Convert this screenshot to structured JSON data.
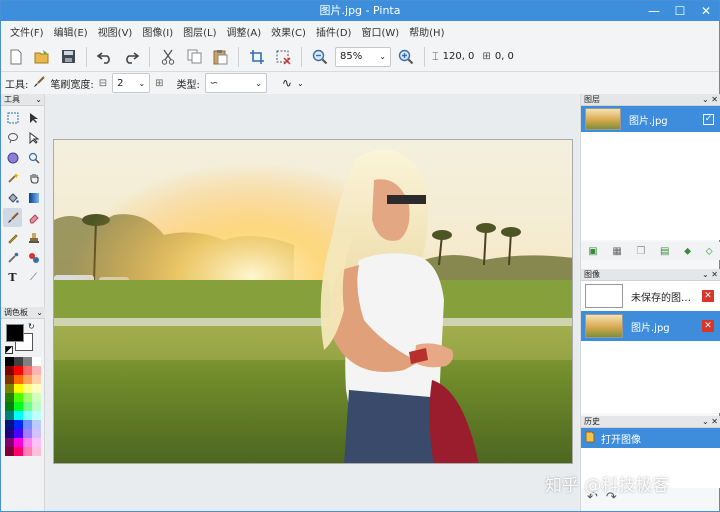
{
  "window": {
    "title": "图片.jpg - Pinta"
  },
  "menubar": [
    "文件(F)",
    "编辑(E)",
    "视图(V)",
    "图像(I)",
    "图层(L)",
    "调整(A)",
    "效果(C)",
    "插件(D)",
    "窗口(W)",
    "帮助(H)"
  ],
  "toolbar": {
    "zoom_value": "85%",
    "size_readout": "120, 0",
    "pos_readout": "0, 0"
  },
  "toolbar2": {
    "tool_label": "工具:",
    "brush_width_label": "笔刷宽度:",
    "brush_width_value": "2",
    "type_label": "类型:",
    "type_value": "∽"
  },
  "tools_panel": {
    "title": "工具"
  },
  "palette_panel": {
    "title": "调色板"
  },
  "layers_panel": {
    "title": "图层",
    "layers": [
      {
        "name": "图片.jpg",
        "visible": true
      }
    ]
  },
  "images_panel": {
    "title": "图像",
    "images": [
      {
        "name": "未保存的图…"
      },
      {
        "name": "图片.jpg"
      }
    ]
  },
  "history_panel": {
    "title": "历史",
    "items": [
      {
        "label": "打开图像"
      }
    ]
  },
  "watermark": {
    "text": "知乎 @科技极客"
  },
  "colors": {
    "accent": "#3d8fdc",
    "selection": "#3e8ddd",
    "close_red": "#d9362b"
  }
}
